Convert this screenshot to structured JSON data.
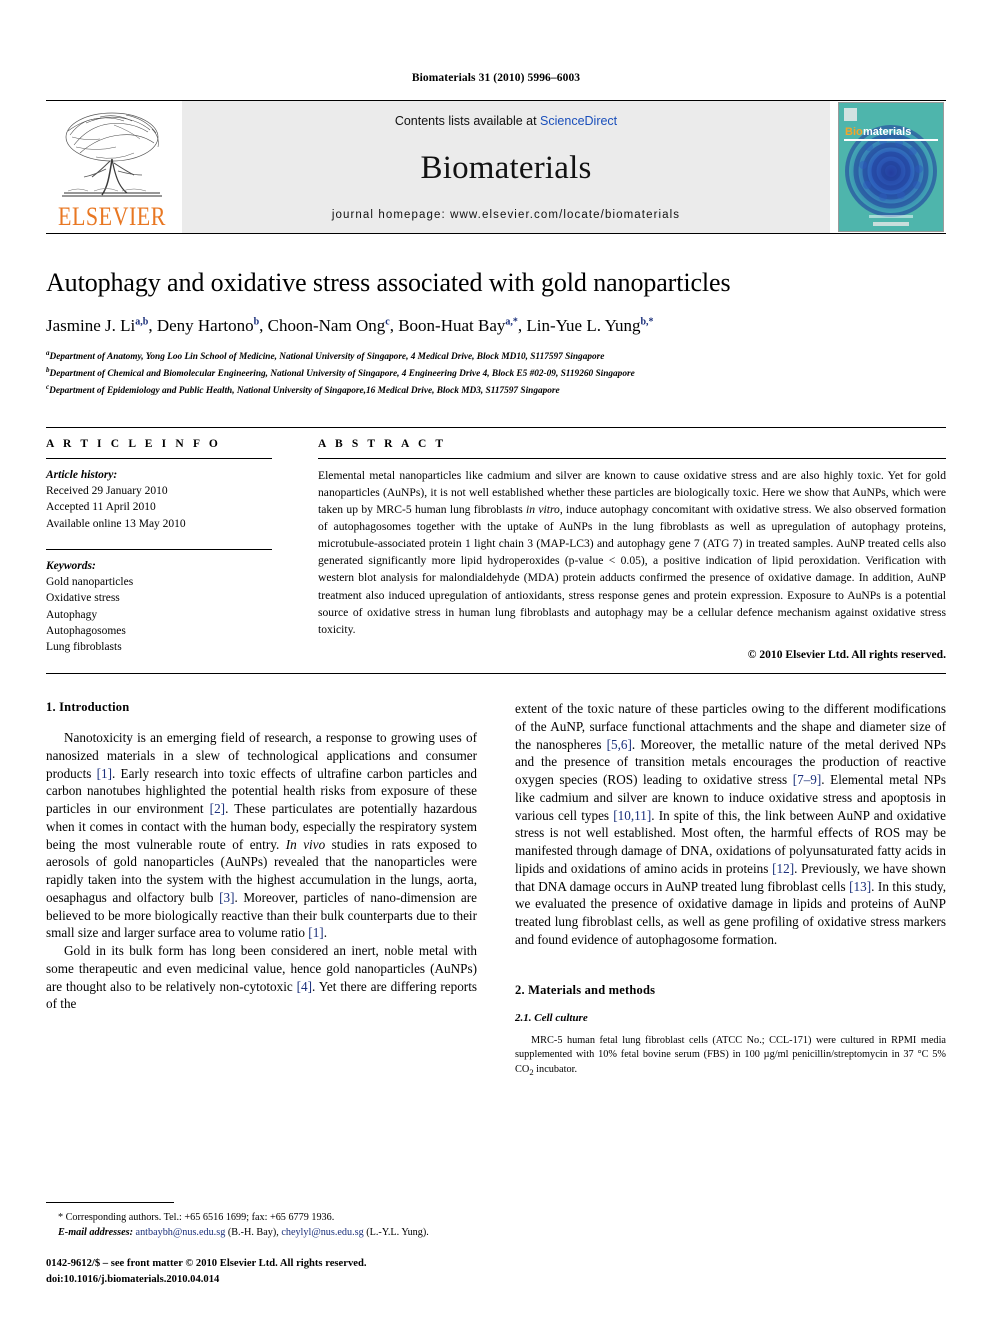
{
  "running_head": "Biomaterials 31 (2010) 5996–6003",
  "masthead": {
    "publisher_wordmark": "ELSEVIER",
    "contents_prefix": "Contents lists available at ",
    "contents_link": "ScienceDirect",
    "journal_name": "Biomaterials",
    "homepage": "journal homepage: www.elsevier.com/locate/biomaterials",
    "cover_title_prefix": "Bio",
    "cover_title_suffix": "materials",
    "cover_accent": "#f4a52a",
    "cover_bg": "#4ab5ad",
    "link_color": "#1a4fbb",
    "elsevier_orange": "#E87722"
  },
  "article": {
    "title": "Autophagy and oxidative stress associated with gold nanoparticles",
    "authors": [
      {
        "name": "Jasmine J. Li",
        "sup": "a,b",
        "sep": ", "
      },
      {
        "name": "Deny Hartono",
        "sup": "b",
        "sep": ", "
      },
      {
        "name": "Choon-Nam Ong",
        "sup": "c",
        "sep": ", "
      },
      {
        "name": "Boon-Huat Bay",
        "sup": "a,*",
        "sep": ", "
      },
      {
        "name": "Lin-Yue L. Yung",
        "sup": "b,*",
        "sep": ""
      }
    ],
    "affiliations": [
      {
        "mark": "a",
        "text": "Department of Anatomy, Yong Loo Lin School of Medicine, National University of Singapore, 4 Medical Drive, Block MD10, S117597 Singapore"
      },
      {
        "mark": "b",
        "text": "Department of Chemical and Biomolecular Engineering, National University of Singapore, 4 Engineering Drive 4, Block E5 #02-09, S119260 Singapore"
      },
      {
        "mark": "c",
        "text": "Department of Epidemiology and Public Health, National University of Singapore,16 Medical Drive, Block MD3, S117597 Singapore"
      }
    ]
  },
  "article_info": {
    "label": "A R T I C L E  I N F O",
    "history_head": "Article history:",
    "history": [
      "Received 29 January 2010",
      "Accepted 11 April 2010",
      "Available online 13 May 2010"
    ],
    "keywords_head": "Keywords:",
    "keywords": [
      "Gold nanoparticles",
      "Oxidative stress",
      "Autophagy",
      "Autophagosomes",
      "Lung fibroblasts"
    ]
  },
  "abstract": {
    "label": "A B S T R A C T",
    "paragraph_1": "Elemental metal nanoparticles like cadmium and silver are known to cause oxidative stress and are also highly toxic. Yet for gold nanoparticles (AuNPs), it is not well established whether these particles are biologically toxic. Here we show that AuNPs, which were taken up by MRC-5 human lung fibroblasts ",
    "in_vitro": "in vitro",
    "paragraph_2": ", induce autophagy concomitant with oxidative stress. We also observed formation of autophagosomes together with the uptake of AuNPs in the lung fibroblasts as well as upregulation of autophagy proteins, microtubule-associated protein 1 light chain 3 (MAP-LC3) and autophagy gene 7 (ATG 7) in treated samples. AuNP treated cells also generated significantly more lipid hydroperoxides (p-value < 0.05), a positive indication of lipid peroxidation. Verification with western blot analysis for malondialdehyde (MDA) protein adducts confirmed the presence of oxidative damage. In addition, AuNP treatment also induced upregulation of antioxidants, stress response genes and protein expression. Exposure to AuNPs is a potential source of oxidative stress in human lung fibroblasts and autophagy may be a cellular defence mechanism against oxidative stress toxicity.",
    "copyright": "© 2010 Elsevier Ltd. All rights reserved."
  },
  "sections": {
    "introduction_heading": "1. Introduction",
    "intro_p1_a": "Nanotoxicity is an emerging field of research, a response to growing uses of nanosized materials in a slew of technological applications and consumer products ",
    "intro_p1_r1": "[1]",
    "intro_p1_b": ". Early research into toxic effects of ultrafine carbon particles and carbon nanotubes highlighted the potential health risks from exposure of these particles in our environment ",
    "intro_p1_r2": "[2]",
    "intro_p1_c": ". These particulates are potentially hazardous when it comes in contact with the human body, especially the respiratory system being the most vulnerable route of entry. ",
    "intro_p1_italic": "In vivo",
    "intro_p1_d": " studies in rats exposed to aerosols of gold nanoparticles (AuNPs) revealed that the nanoparticles were rapidly taken into the system with the highest accumulation in the lungs, aorta, oesaphagus and olfactory bulb ",
    "intro_p1_r3": "[3]",
    "intro_p1_e": ". Moreover, particles of nano-dimension are believed to be more biologically reactive than their bulk counterparts due to their small size and larger surface area to volume ratio ",
    "intro_p1_r4": "[1]",
    "intro_p1_f": ".",
    "intro_p2_a": "Gold in its bulk form has long been considered an inert, noble metal with some therapeutic and even medicinal value, hence gold nanoparticles (AuNPs) are thought also to be relatively non-cytotoxic ",
    "intro_p2_r1": "[4]",
    "intro_p2_b": ". Yet there are differing reports of the",
    "intro_p3_a": "extent of the toxic nature of these particles owing to the different modifications of the AuNP, surface functional attachments and the shape and diameter size of the nanospheres ",
    "intro_p3_r1": "[5,6]",
    "intro_p3_b": ". Moreover, the metallic nature of the metal derived NPs and the presence of transition metals encourages the production of reactive oxygen species (ROS) leading to oxidative stress ",
    "intro_p3_r2": "[7–9]",
    "intro_p3_c": ". Elemental metal NPs like cadmium and silver are known to induce oxidative stress and apoptosis in various cell types ",
    "intro_p3_r3": "[10,11]",
    "intro_p3_d": ". In spite of this, the link between AuNP and oxidative stress is not well established. Most often, the harmful effects of ROS may be manifested through damage of DNA, oxidations of polyunsaturated fatty acids in lipids and oxidations of amino acids in proteins ",
    "intro_p3_r4": "[12]",
    "intro_p3_e": ". Previously, we have shown that DNA damage occurs in AuNP treated lung fibroblast cells ",
    "intro_p3_r5": "[13]",
    "intro_p3_f": ". In this study, we evaluated the presence of oxidative damage in lipids and proteins of AuNP treated lung fibroblast cells, as well as gene profiling of oxidative stress markers and found evidence of autophagosome formation.",
    "methods_heading": "2. Materials and methods",
    "cell_culture_heading": "2.1. Cell culture",
    "cell_culture_text_a": "MRC-5 human fetal lung fibroblast cells (ATCC No.; CCL-171) were cultured in RPMI media supplemented with 10% fetal bovine serum (FBS) in 100 µg/ml penicillin/streptomycin in 37 °C 5% CO",
    "cell_culture_sub": "2",
    "cell_culture_text_b": " incubator."
  },
  "footnotes": {
    "corresponding": "* Corresponding authors. Tel.: +65 6516 1699; fax: +65 6779 1936.",
    "email_label": "E-mail addresses:",
    "email_1": "antbaybh@nus.edu.sg",
    "email_1_owner": " (B.-H. Bay), ",
    "email_2": "cheylyl@nus.edu.sg",
    "email_2_owner": " (L.-Y.L. Yung).",
    "issn_line": "0142-9612/$ – see front matter © 2010 Elsevier Ltd. All rights reserved.",
    "doi_line": "doi:10.1016/j.biomaterials.2010.04.014"
  }
}
